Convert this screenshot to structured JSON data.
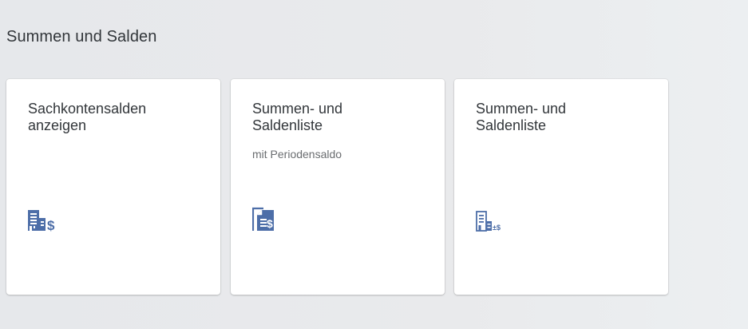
{
  "group": {
    "title": "Summen und Salden"
  },
  "tiles": [
    {
      "title_line1": "Sachkontensalden",
      "title_line2": "anzeigen",
      "icon": "building-dollar-icon"
    },
    {
      "title_line1": "Summen- und",
      "title_line2": "Saldenliste",
      "subtitle": "mit Periodensaldo",
      "icon": "document-dollar-icon"
    },
    {
      "title_line1": "Summen- und",
      "title_line2": "Saldenliste",
      "icon": "building-balance-icon"
    }
  ],
  "colors": {
    "background": "#e9eaec",
    "tile": "#ffffff",
    "text": "#32363a",
    "subtext": "#6a6d70",
    "icon": "#4d6ea8"
  }
}
